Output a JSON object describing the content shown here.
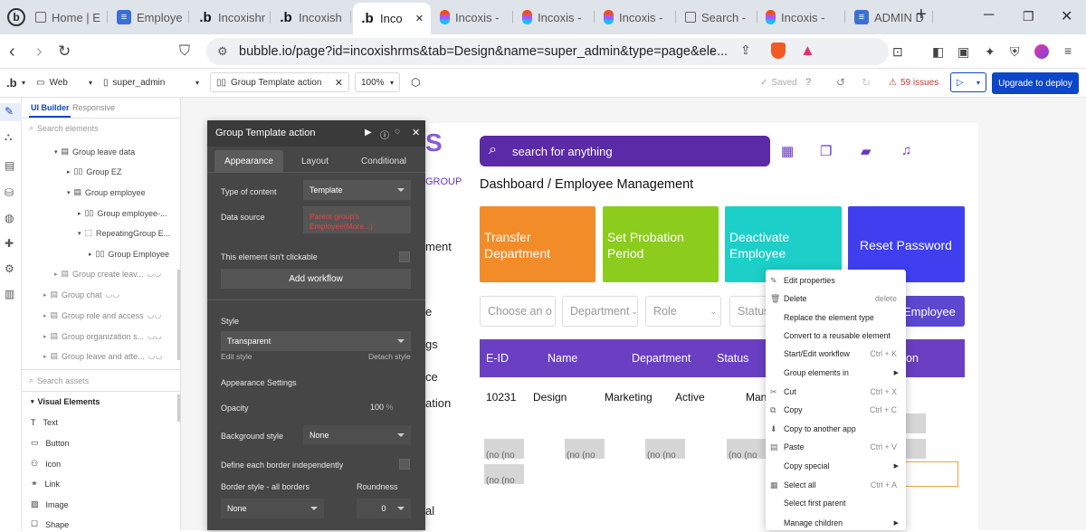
{
  "browser": {
    "tabs": [
      {
        "label": "Home | E",
        "icon": "home-icon"
      },
      {
        "label": "Employe",
        "icon": "doc-icon"
      },
      {
        "label": "Incoxishr",
        "icon": "bubble-icon"
      },
      {
        "label": "Incoxish",
        "icon": "bubble-icon"
      },
      {
        "label": "Inco",
        "icon": "bubble-icon"
      },
      {
        "label": "Incoxis -",
        "icon": "figma-icon"
      },
      {
        "label": "Incoxis -",
        "icon": "figma-icon"
      },
      {
        "label": "Incoxis -",
        "icon": "figma-icon"
      },
      {
        "label": "Search -",
        "icon": "home-icon"
      },
      {
        "label": "Incoxis -",
        "icon": "figma-icon"
      },
      {
        "label": "ADMIN D",
        "icon": "doc-icon"
      }
    ],
    "url": "bubble.io/page?id=incoxishrms&tab=Design&name=super_admin&type=page&ele..."
  },
  "toolbar": {
    "logo": ".b",
    "platform": "Web",
    "page": "super_admin",
    "element": "Group Template action",
    "zoom": "100%",
    "saved": "Saved",
    "issues": "59 issues",
    "deploy": "Upgrade to deploy"
  },
  "tree": {
    "tabs": {
      "builder": "UI Builder",
      "responsive": "Responsive"
    },
    "search_placeholder": "Search elements",
    "items": [
      {
        "label": "Group leave data"
      },
      {
        "label": "Group EZ"
      },
      {
        "label": "Group employee"
      },
      {
        "label": "Group employee-..."
      },
      {
        "label": "RepeatingGroup E..."
      },
      {
        "label": "Group Employee"
      },
      {
        "label": "Group create leav..."
      },
      {
        "label": "Group chat"
      },
      {
        "label": "Group role and access"
      },
      {
        "label": "Group organization s..."
      },
      {
        "label": "Group leave and atte..."
      }
    ],
    "assets_placeholder": "Search assets",
    "visual_header": "Visual Elements",
    "visual_elements": [
      {
        "label": "Text",
        "icon": "text-icon"
      },
      {
        "label": "Button",
        "icon": "button-icon"
      },
      {
        "label": "Icon",
        "icon": "icon-icon"
      },
      {
        "label": "Link",
        "icon": "link-icon"
      },
      {
        "label": "Image",
        "icon": "image-icon"
      },
      {
        "label": "Shape",
        "icon": "shape-icon"
      }
    ]
  },
  "editor": {
    "title": "Group Template action",
    "tabs": {
      "appearance": "Appearance",
      "layout": "Layout",
      "conditional": "Conditional"
    },
    "type_label": "Type of content",
    "type_value": "Template",
    "source_label": "Data source",
    "source_value": "Parent group's Employee(More...)",
    "clickable_label": "This element isn't clickable",
    "add_workflow": "Add workflow",
    "style_label": "Style",
    "style_value": "Transparent",
    "edit_style": "Edit style",
    "detach_style": "Detach style",
    "appearance_settings": "Appearance Settings",
    "opacity_label": "Opacity",
    "opacity_value": "100",
    "opacity_unit": "%",
    "bg_label": "Background style",
    "bg_value": "None",
    "border_indep": "Define each border independently",
    "border_label": "Border style - all borders",
    "roundness_label": "Roundness",
    "border_value": "None",
    "roundness_value": "0"
  },
  "page": {
    "logo_fragment": "S",
    "group_fragment": "GROUP",
    "left_fragments": [
      "ment",
      "e",
      "gs",
      "ce",
      "ation",
      "al"
    ],
    "search_placeholder": "search for anything",
    "breadcrumb": "Dashboard / Employee Management",
    "cards": [
      {
        "label": "Transfer Department",
        "color": "#f28c28"
      },
      {
        "label": "Set Probation Period",
        "color": "#8ccc1d"
      },
      {
        "label": "Deactivate Employee",
        "color": "#1ccfc9"
      },
      {
        "label": "Reset Password",
        "color": "#3f3ff0"
      }
    ],
    "filters": [
      "Choose an o",
      "Department",
      "Role",
      "Status"
    ],
    "add_button": "Employee",
    "table": {
      "headers": [
        "E-ID",
        "Name",
        "Department",
        "Status",
        "on"
      ],
      "row": [
        "10231",
        "Design",
        "Marketing",
        "Active",
        "Man"
      ],
      "placeholder": "(no (no"
    }
  },
  "menu": [
    {
      "label": "Edit properties",
      "icon": "edit-icon",
      "shortcut": ""
    },
    {
      "label": "Delete",
      "icon": "trash-icon",
      "shortcut": "delete"
    },
    {
      "label": "Replace the element type",
      "icon": "",
      "shortcut": ""
    },
    {
      "label": "Convert to a reusable element",
      "icon": "",
      "shortcut": ""
    },
    {
      "label": "Start/Edit workflow",
      "icon": "",
      "shortcut": "Ctrl + K"
    },
    {
      "label": "Group elements in",
      "icon": "",
      "shortcut": "",
      "submenu": true
    },
    {
      "label": "Cut",
      "icon": "scissors-icon",
      "shortcut": "Ctrl + X"
    },
    {
      "label": "Copy",
      "icon": "copy-icon",
      "shortcut": "Ctrl + C"
    },
    {
      "label": "Copy to another app",
      "icon": "download-icon",
      "shortcut": ""
    },
    {
      "label": "Paste",
      "icon": "paste-icon",
      "shortcut": "Ctrl + V"
    },
    {
      "label": "Copy special",
      "icon": "",
      "shortcut": "",
      "submenu": true
    },
    {
      "label": "Select all",
      "icon": "select-all-icon",
      "shortcut": "Ctrl + A"
    },
    {
      "label": "Select first parent",
      "icon": "",
      "shortcut": ""
    },
    {
      "label": "Manage children",
      "icon": "",
      "shortcut": "",
      "submenu": true
    }
  ]
}
